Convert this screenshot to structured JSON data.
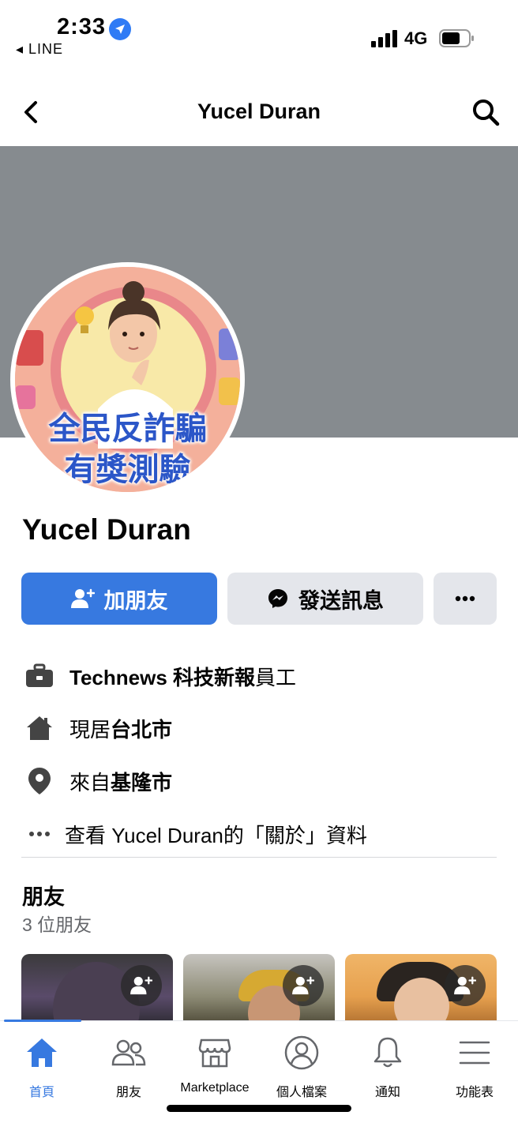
{
  "status_bar": {
    "time": "2:33",
    "back_app": "◂ LINE",
    "network": "4G"
  },
  "navbar": {
    "title": "Yucel Duran"
  },
  "avatar": {
    "line1": "全民反詐騙",
    "line2": "有獎測驗"
  },
  "profile": {
    "name": "Yucel Duran"
  },
  "actions": {
    "add_friend": "加朋友",
    "send_message": "發送訊息"
  },
  "info": {
    "work_bold": "Technews 科技新報",
    "work_rest": "員工",
    "lives_prefix": "現居",
    "lives_city": "台北市",
    "from_prefix": "來自",
    "from_city": "基隆市",
    "about": "查看 Yucel Duran的「關於」資料"
  },
  "friends": {
    "title": "朋友",
    "count": "3 位朋友"
  },
  "tabs": [
    {
      "label": "首頁",
      "icon": "home-icon",
      "active": true
    },
    {
      "label": "朋友",
      "icon": "friends-icon",
      "active": false
    },
    {
      "label": "Marketplace",
      "icon": "marketplace-icon",
      "active": false
    },
    {
      "label": "個人檔案",
      "icon": "profile-icon",
      "active": false
    },
    {
      "label": "通知",
      "icon": "bell-icon",
      "active": false
    },
    {
      "label": "功能表",
      "icon": "menu-icon",
      "active": false
    }
  ],
  "colors": {
    "accent": "#3779e0",
    "cover": "#868b8f",
    "button_gray": "#e4e6eb"
  }
}
